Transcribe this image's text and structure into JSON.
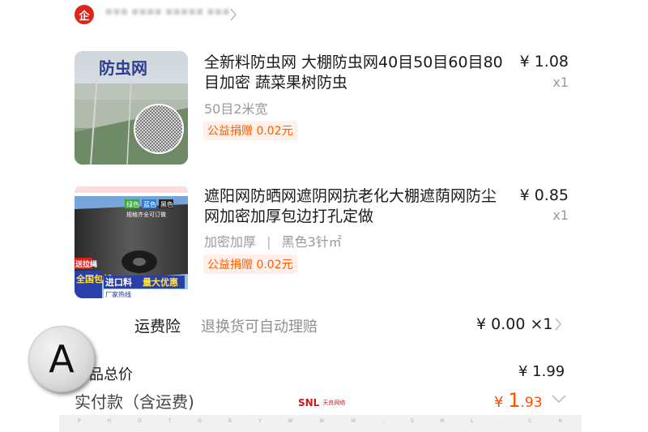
{
  "shop": {
    "logo_text": "企",
    "name": "■■■ ■■■■ ■■■■■ ■■■"
  },
  "products": [
    {
      "title": "全新料防虫网 大棚防虫网40目50目60目80目加密 蔬菜果树防虫",
      "thumb_caption": "防虫网",
      "variant": "50目2米宽",
      "price": "¥ 1.08",
      "qty": "x1",
      "charity": "公益捐赠 0.02元"
    },
    {
      "title": "遮阳网防晒网遮阴网抗老化大棚遮荫网防尘网加密加厚包边打孔定做",
      "thumb_tags": [
        "绿色",
        "蓝色",
        "黑色"
      ],
      "thumb_note": "规格齐全可订做",
      "thumb_badges": [
        "送拉绳",
        "全国包邮",
        "进口料",
        "量大优惠",
        "厂家热线"
      ],
      "variant_a": "加密加厚",
      "variant_b": "黑色3针㎡",
      "price": "¥ 0.85",
      "qty": "x1",
      "charity": "公益捐赠 0.02元"
    }
  ],
  "insurance": {
    "label": "运费险",
    "desc": "退换货可自动理赔",
    "price": "¥ 0.00 ×1"
  },
  "totals": {
    "goods_label": "商品总价",
    "goods_value": "¥ 1.99",
    "pay_label": "实付款（含运费)",
    "pay_yen": "¥ ",
    "pay_int": "1",
    "pay_dec": ".93"
  },
  "watermark": {
    "brand": "SNL",
    "sub": "天良网络"
  },
  "photo_credit": [
    "P",
    "H",
    "O",
    "T",
    "O",
    "B",
    "Y",
    "W",
    "W",
    "W",
    ".",
    "S",
    "N",
    "L",
    ".",
    "C",
    "N"
  ],
  "badge_letter": "A",
  "colors": {
    "accent": "#ff4f00",
    "charity_bg": "#fff1ea",
    "muted": "#9a9a9a",
    "logo_red": "#d8261c"
  }
}
